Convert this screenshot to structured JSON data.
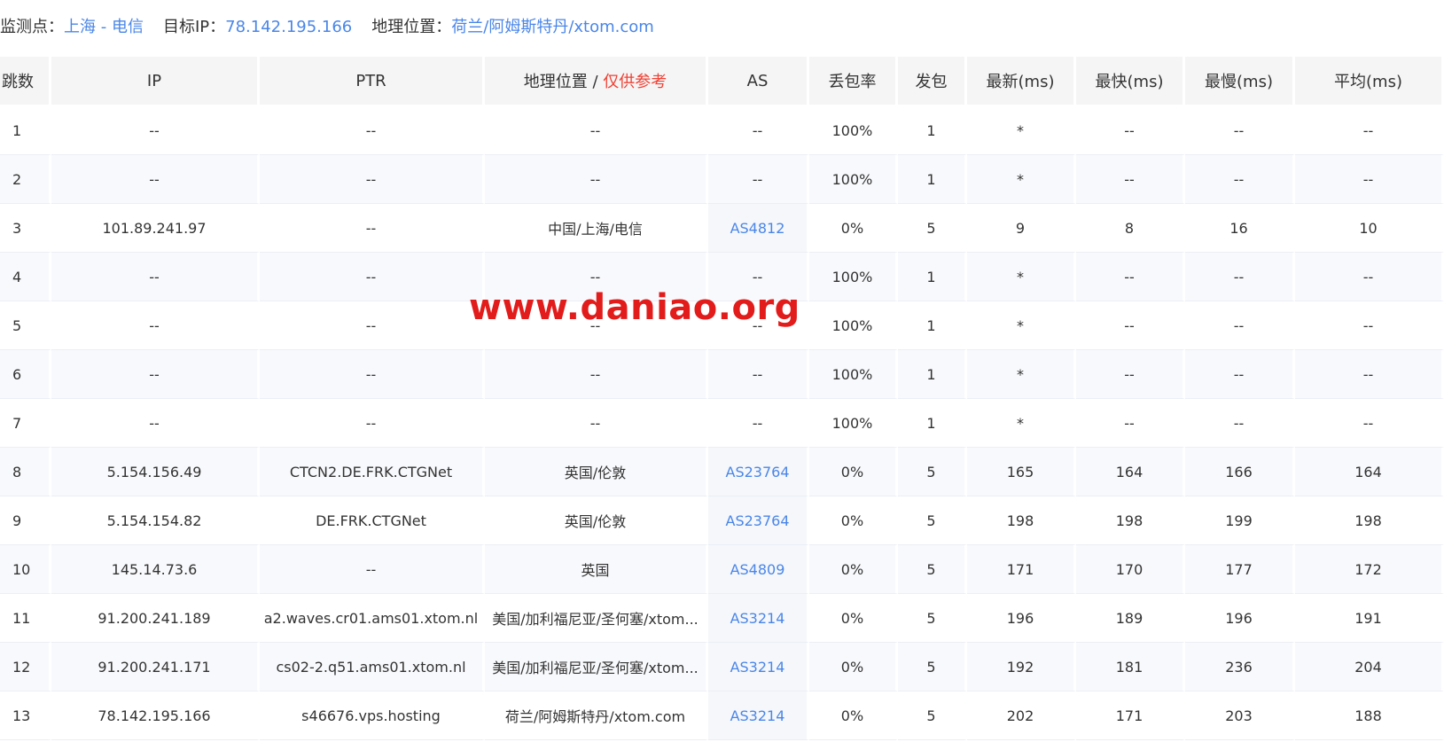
{
  "info": {
    "monitor_label": "监测点：",
    "monitor_value": "上海 - 电信",
    "target_label": "目标IP：",
    "target_value": "78.142.195.166",
    "location_label": "地理位置：",
    "location_value": "荷兰/阿姆斯特丹/xtom.com"
  },
  "headers": {
    "hop": "跳数",
    "ip": "IP",
    "ptr": "PTR",
    "geo": "地理位置 / ",
    "geo_note": "仅供参考",
    "as": "AS",
    "loss": "丢包率",
    "sent": "发包",
    "last": "最新(ms)",
    "best": "最快(ms)",
    "worst": "最慢(ms)",
    "avg": "平均(ms)"
  },
  "rows": [
    {
      "hop": "1",
      "ip": "--",
      "ptr": "--",
      "geo": "--",
      "as": "--",
      "loss": "100%",
      "sent": "1",
      "last": "*",
      "best": "--",
      "worst": "--",
      "avg": "--"
    },
    {
      "hop": "2",
      "ip": "--",
      "ptr": "--",
      "geo": "--",
      "as": "--",
      "loss": "100%",
      "sent": "1",
      "last": "*",
      "best": "--",
      "worst": "--",
      "avg": "--"
    },
    {
      "hop": "3",
      "ip": "101.89.241.97",
      "ptr": "--",
      "geo": "中国/上海/电信",
      "as": "AS4812",
      "loss": "0%",
      "sent": "5",
      "last": "9",
      "best": "8",
      "worst": "16",
      "avg": "10"
    },
    {
      "hop": "4",
      "ip": "--",
      "ptr": "--",
      "geo": "--",
      "as": "--",
      "loss": "100%",
      "sent": "1",
      "last": "*",
      "best": "--",
      "worst": "--",
      "avg": "--"
    },
    {
      "hop": "5",
      "ip": "--",
      "ptr": "--",
      "geo": "--",
      "as": "--",
      "loss": "100%",
      "sent": "1",
      "last": "*",
      "best": "--",
      "worst": "--",
      "avg": "--"
    },
    {
      "hop": "6",
      "ip": "--",
      "ptr": "--",
      "geo": "--",
      "as": "--",
      "loss": "100%",
      "sent": "1",
      "last": "*",
      "best": "--",
      "worst": "--",
      "avg": "--"
    },
    {
      "hop": "7",
      "ip": "--",
      "ptr": "--",
      "geo": "--",
      "as": "--",
      "loss": "100%",
      "sent": "1",
      "last": "*",
      "best": "--",
      "worst": "--",
      "avg": "--"
    },
    {
      "hop": "8",
      "ip": "5.154.156.49",
      "ptr": "CTCN2.DE.FRK.CTGNet",
      "geo": "英国/伦敦",
      "as": "AS23764",
      "loss": "0%",
      "sent": "5",
      "last": "165",
      "best": "164",
      "worst": "166",
      "avg": "164"
    },
    {
      "hop": "9",
      "ip": "5.154.154.82",
      "ptr": "DE.FRK.CTGNet",
      "geo": "英国/伦敦",
      "as": "AS23764",
      "loss": "0%",
      "sent": "5",
      "last": "198",
      "best": "198",
      "worst": "199",
      "avg": "198"
    },
    {
      "hop": "10",
      "ip": "145.14.73.6",
      "ptr": "--",
      "geo": "英国",
      "as": "AS4809",
      "loss": "0%",
      "sent": "5",
      "last": "171",
      "best": "170",
      "worst": "177",
      "avg": "172"
    },
    {
      "hop": "11",
      "ip": "91.200.241.189",
      "ptr": "a2.waves.cr01.ams01.xtom.nl",
      "geo": "美国/加利福尼亚/圣何塞/xtom...",
      "as": "AS3214",
      "loss": "0%",
      "sent": "5",
      "last": "196",
      "best": "189",
      "worst": "196",
      "avg": "191"
    },
    {
      "hop": "12",
      "ip": "91.200.241.171",
      "ptr": "cs02-2.q51.ams01.xtom.nl",
      "geo": "美国/加利福尼亚/圣何塞/xtom...",
      "as": "AS3214",
      "loss": "0%",
      "sent": "5",
      "last": "192",
      "best": "181",
      "worst": "236",
      "avg": "204"
    },
    {
      "hop": "13",
      "ip": "78.142.195.166",
      "ptr": "s46676.vps.hosting",
      "geo": "荷兰/阿姆斯特丹/xtom.com",
      "as": "AS3214",
      "loss": "0%",
      "sent": "5",
      "last": "202",
      "best": "171",
      "worst": "203",
      "avg": "188"
    }
  ],
  "watermark": "www.daniao.org",
  "colors": {
    "link": "#4a86e8",
    "note": "#f04134",
    "watermark": "#e21b1b",
    "header_bg": "#f5f5f5"
  }
}
